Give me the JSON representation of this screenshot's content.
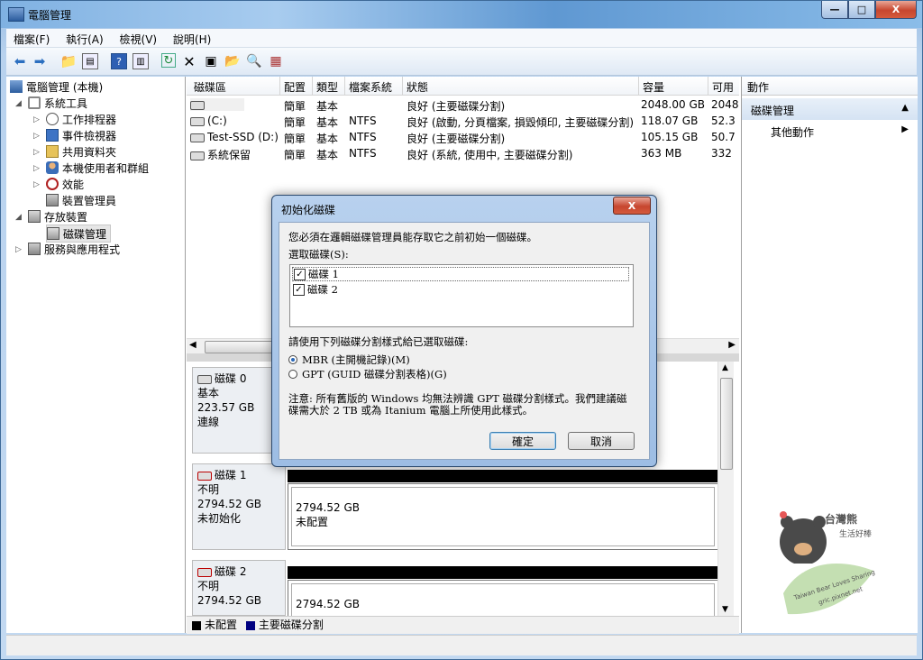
{
  "window": {
    "title": "電腦管理",
    "min": "—",
    "max": "□",
    "close": "X"
  },
  "menu": [
    "檔案(F)",
    "執行(A)",
    "檢視(V)",
    "說明(H)"
  ],
  "tree": {
    "root": "電腦管理 (本機)",
    "system_tools": "系統工具",
    "task_scheduler": "工作排程器",
    "event_viewer": "事件檢視器",
    "shared_folders": "共用資料夾",
    "local_users": "本機使用者和群組",
    "performance": "效能",
    "device_manager": "裝置管理員",
    "storage": "存放裝置",
    "disk_management": "磁碟管理",
    "services_apps": "服務與應用程式"
  },
  "volumes": {
    "headers": [
      "磁碟區",
      "配置",
      "類型",
      "檔案系統",
      "狀態",
      "容量",
      "可用"
    ],
    "rows": [
      {
        "name": "",
        "layout": "簡單",
        "type": "基本",
        "fs": "",
        "status": "良好 (主要磁碟分割)",
        "capacity": "2048.00 GB",
        "free": "2048"
      },
      {
        "name": "(C:)",
        "layout": "簡單",
        "type": "基本",
        "fs": "NTFS",
        "status": "良好 (啟動, 分頁檔案, 損毀傾印, 主要磁碟分割)",
        "capacity": "118.07 GB",
        "free": "52.3"
      },
      {
        "name": "Test-SSD (D:)",
        "layout": "簡單",
        "type": "基本",
        "fs": "NTFS",
        "status": "良好 (主要磁碟分割)",
        "capacity": "105.15 GB",
        "free": "50.7"
      },
      {
        "name": "系統保留",
        "layout": "簡單",
        "type": "基本",
        "fs": "NTFS",
        "status": "良好 (系統, 使用中, 主要磁碟分割)",
        "capacity": "363 MB",
        "free": "332"
      }
    ]
  },
  "disks": [
    {
      "name": "磁碟 0",
      "type": "基本",
      "size": "223.57 GB",
      "state": "連線"
    },
    {
      "name": "磁碟 1",
      "type": "不明",
      "size": "2794.52 GB",
      "state": "未初始化",
      "part_size": "2794.52 GB",
      "part_state": "未配置"
    },
    {
      "name": "磁碟 2",
      "type": "不明",
      "size": "2794.52 GB",
      "part_size": "2794.52 GB"
    }
  ],
  "legend": {
    "unallocated": "未配置",
    "primary": "主要磁碟分割",
    "unallocated_color": "#000000",
    "primary_color": "#000080"
  },
  "actions": {
    "header": "動作",
    "section": "磁碟管理",
    "more": "其他動作"
  },
  "dialog": {
    "title": "初始化磁碟",
    "close": "X",
    "intro": "您必須在邏輯磁碟管理員能存取它之前初始一個磁碟。",
    "select_label": "選取磁碟(S):",
    "disks": [
      "磁碟 1",
      "磁碟 2"
    ],
    "style_label": "請使用下列磁碟分割樣式給已選取磁碟:",
    "mbr": "MBR (主開機記錄)(M)",
    "gpt": "GPT (GUID 磁碟分割表格)(G)",
    "note_line1": "注意: 所有舊版的 Windows 均無法辨識 GPT 磁碟分割樣式。我們建議磁",
    "note_line2": "碟需大於 2 TB 或為 Itanium 電腦上所使用此樣式。",
    "ok": "確定",
    "cancel": "取消"
  },
  "watermark": {
    "line1": "台灣熊",
    "line2": "生活好棒",
    "line3": "Taiwan Bear Loves Sharing",
    "line4": "gric.pixnet.net"
  }
}
